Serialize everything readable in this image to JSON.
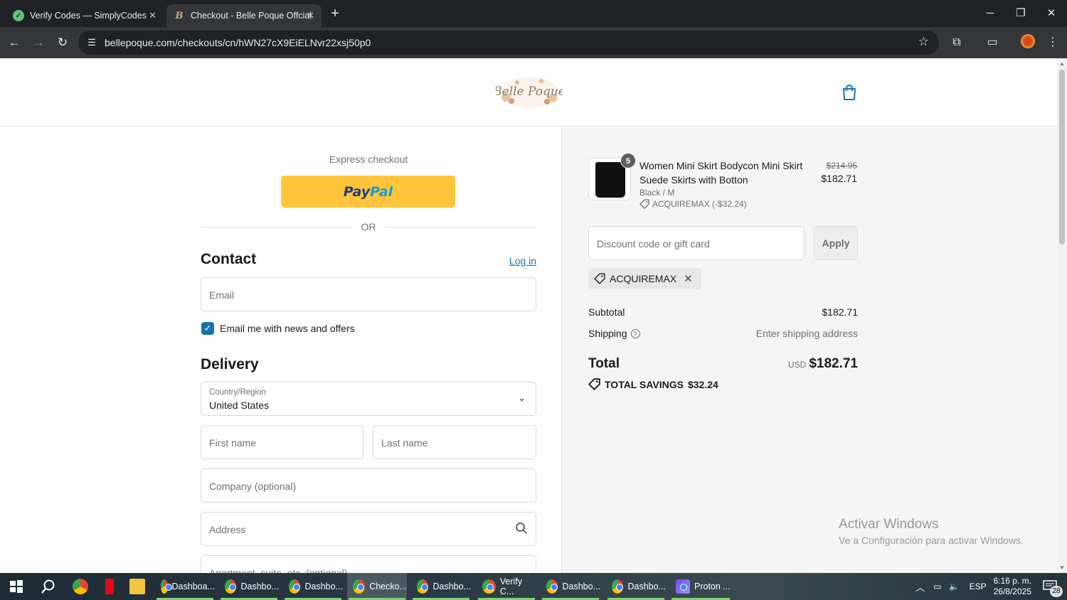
{
  "browser": {
    "tabs": [
      {
        "title": "Verify Codes — SimplyCodes",
        "icon": "simplycodes-icon"
      },
      {
        "title": "Checkout - Belle Poque Offcial",
        "icon": "bellepoque-icon"
      }
    ],
    "url": "bellepoque.com/checkouts/cn/hWN27cX9EiELNvr22xsj50p0"
  },
  "shop": {
    "logo_text": "Belle Poque",
    "express_checkout": "Express checkout",
    "paypal_pay": "Pay",
    "paypal_pal": "Pal",
    "or": "OR",
    "contact": {
      "heading": "Contact",
      "login": "Log in",
      "email_placeholder": "Email",
      "news_label": "Email me with news and offers",
      "news_checked": true
    },
    "delivery": {
      "heading": "Delivery",
      "country_label": "Country/Region",
      "country_value": "United States",
      "first_name": "First name",
      "last_name": "Last name",
      "company": "Company (optional)",
      "address": "Address",
      "apartment": "Apartment, suite, etc. (optional)"
    }
  },
  "summary": {
    "product": {
      "quantity": "5",
      "name": "Women Mini Skirt Bodycon Mini Skirt Suede Skirts with Botton",
      "variant": "Black / M",
      "discount": "ACQUIREMAX (-$32.24)",
      "old_price": "$214.95",
      "new_price": "$182.71"
    },
    "discount_placeholder": "Discount code or gift card",
    "apply": "Apply",
    "applied_code": "ACQUIREMAX",
    "subtotal_label": "Subtotal",
    "subtotal_value": "$182.71",
    "shipping_label": "Shipping",
    "shipping_value": "Enter shipping address",
    "total_label": "Total",
    "total_currency": "USD",
    "total_value": "$182.71",
    "savings_label": "TOTAL SAVINGS",
    "savings_value": "$32.24"
  },
  "watermark": {
    "title": "Activar Windows",
    "subtitle": "Ve a Configuración para activar Windows."
  },
  "taskbar": {
    "apps": [
      {
        "label": "Dashboa..."
      },
      {
        "label": "Dashbo..."
      },
      {
        "label": "Dashbo..."
      },
      {
        "label": "Checko..."
      },
      {
        "label": "Dashbo..."
      },
      {
        "label": "Verify C..."
      },
      {
        "label": "Dashbo..."
      },
      {
        "label": "Dashbo..."
      },
      {
        "label": "Proton ..."
      }
    ],
    "language": "ESP",
    "time": "6:16 p. m.",
    "date": "26/8/2025",
    "notifications": "28"
  }
}
